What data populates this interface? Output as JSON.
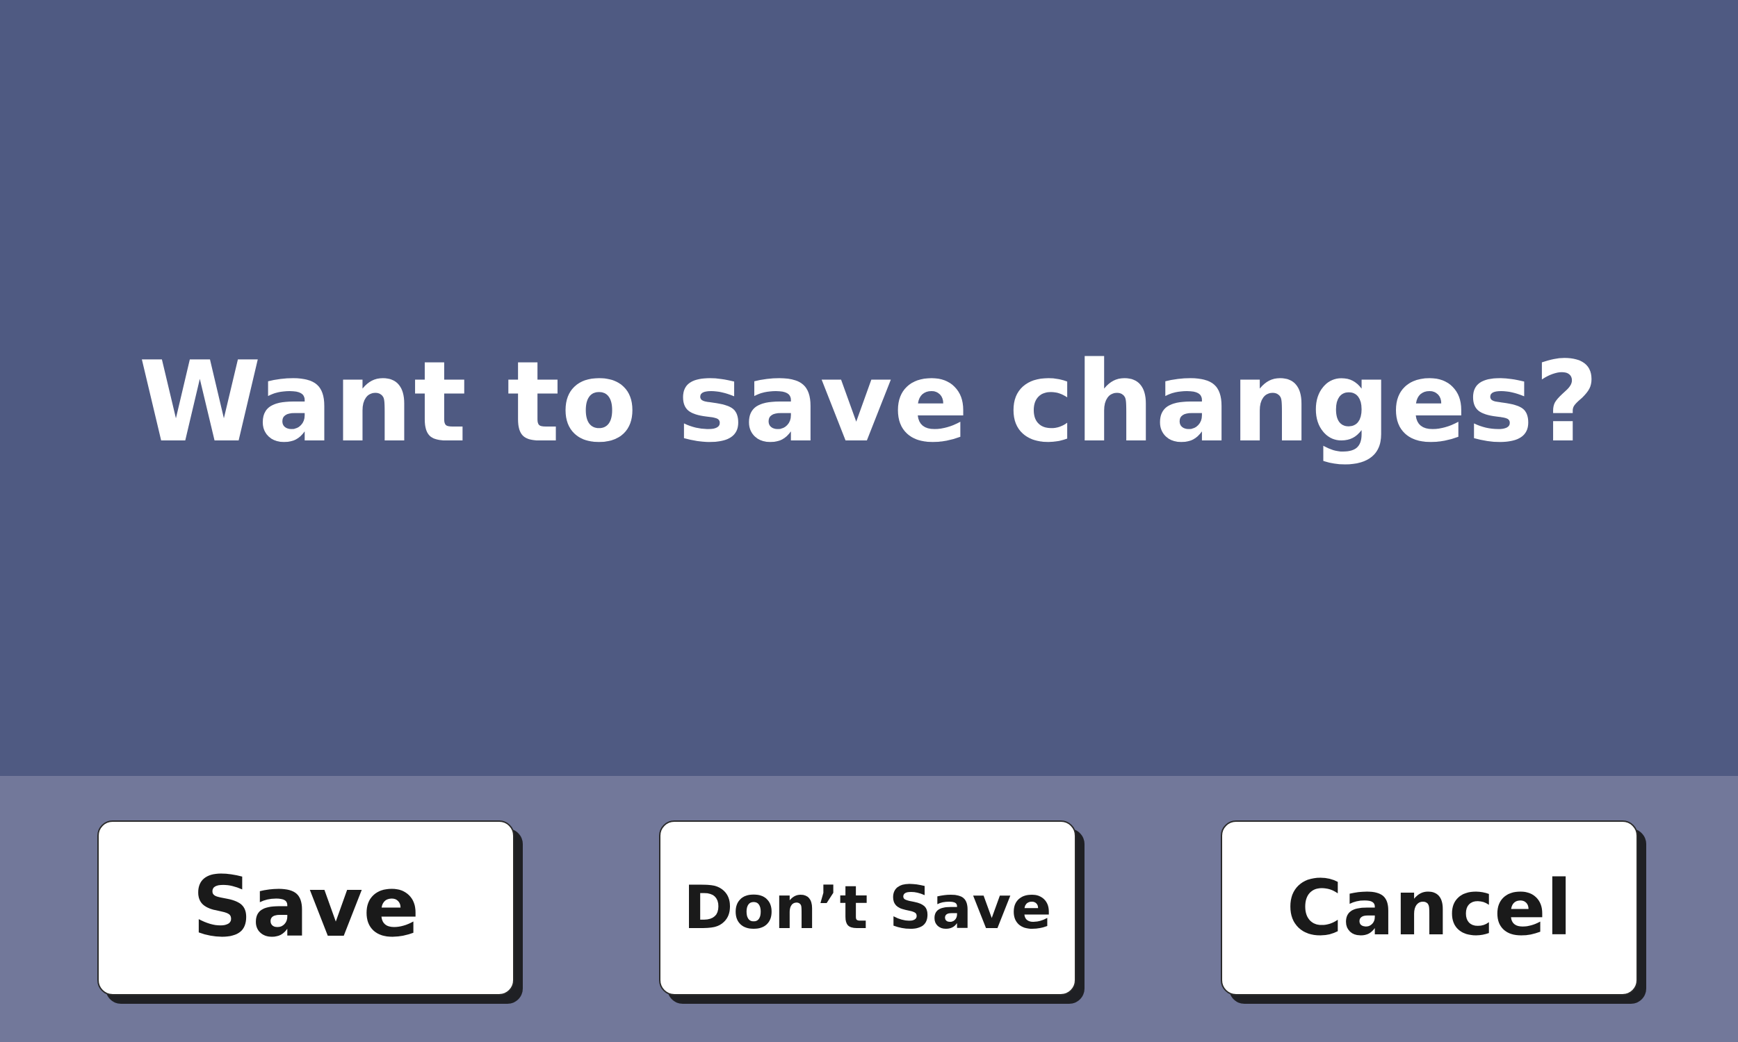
{
  "dialog": {
    "message": "Want to save changes?",
    "buttons": {
      "save": "Save",
      "dont_save": "Don’t Save",
      "cancel": "Cancel"
    }
  },
  "colors": {
    "message_panel_bg": "#4f5a82",
    "button_bar_bg": "#72789a",
    "button_bg": "#ffffff",
    "button_text": "#1a1a1a",
    "message_text": "#ffffff"
  }
}
